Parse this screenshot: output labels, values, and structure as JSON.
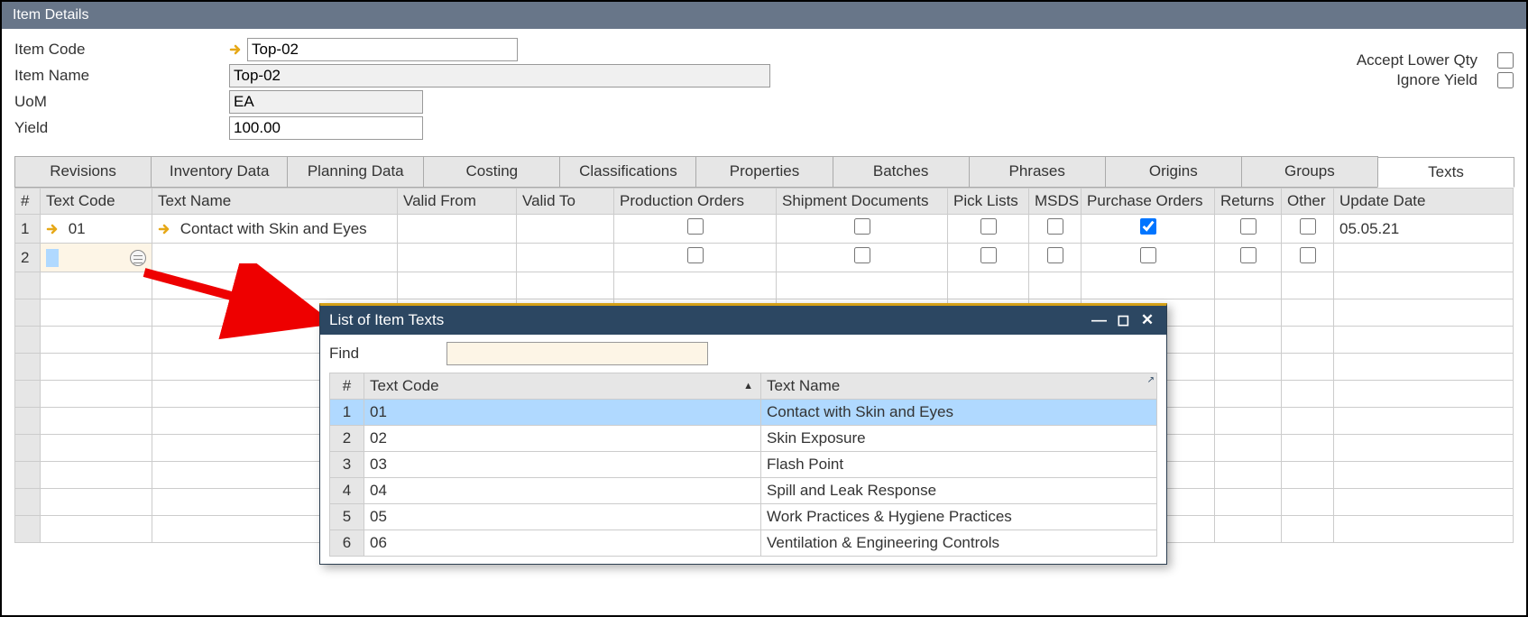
{
  "title": "Item Details",
  "form": {
    "itemCode": {
      "label": "Item Code",
      "value": "Top-02"
    },
    "itemName": {
      "label": "Item Name",
      "value": "Top-02"
    },
    "uom": {
      "label": "UoM",
      "value": "EA"
    },
    "yield": {
      "label": "Yield",
      "value": "100.00"
    }
  },
  "checkboxes": {
    "acceptLowerQty": {
      "label": "Accept Lower Qty",
      "checked": false
    },
    "ignoreYield": {
      "label": "Ignore Yield",
      "checked": false
    }
  },
  "tabs": [
    "Revisions",
    "Inventory Data",
    "Planning Data",
    "Costing",
    "Classifications",
    "Properties",
    "Batches",
    "Phrases",
    "Origins",
    "Groups",
    "Texts"
  ],
  "activeTab": "Texts",
  "grid": {
    "columns": [
      "#",
      "Text Code",
      "Text Name",
      "Valid From",
      "Valid To",
      "Production Orders",
      "Shipment Documents",
      "Pick Lists",
      "MSDS",
      "Purchase Orders",
      "Returns",
      "Other",
      "Update Date"
    ],
    "rows": [
      {
        "num": "1",
        "textCode": "01",
        "textName": "Contact with Skin and Eyes",
        "validFrom": "",
        "validTo": "",
        "prodOrders": false,
        "shipDocs": false,
        "pickLists": false,
        "msds": false,
        "purchOrders": true,
        "returns": false,
        "other": false,
        "updateDate": "05.05.21"
      },
      {
        "num": "2",
        "textCode": "",
        "textName": "",
        "validFrom": "",
        "validTo": "",
        "prodOrders": false,
        "shipDocs": false,
        "pickLists": false,
        "msds": false,
        "purchOrders": false,
        "returns": false,
        "other": false,
        "updateDate": ""
      }
    ]
  },
  "popup": {
    "title": "List of Item Texts",
    "findLabel": "Find",
    "findValue": "",
    "columns": [
      "#",
      "Text Code",
      "Text Name"
    ],
    "rows": [
      {
        "num": "1",
        "code": "01",
        "name": "Contact with Skin and Eyes",
        "selected": true
      },
      {
        "num": "2",
        "code": "02",
        "name": "Skin Exposure",
        "selected": false
      },
      {
        "num": "3",
        "code": "03",
        "name": "Flash Point",
        "selected": false
      },
      {
        "num": "4",
        "code": "04",
        "name": "Spill and Leak Response",
        "selected": false
      },
      {
        "num": "5",
        "code": "05",
        "name": "Work Practices & Hygiene Practices",
        "selected": false
      },
      {
        "num": "6",
        "code": "06",
        "name": "Ventilation & Engineering Controls",
        "selected": false
      }
    ]
  }
}
